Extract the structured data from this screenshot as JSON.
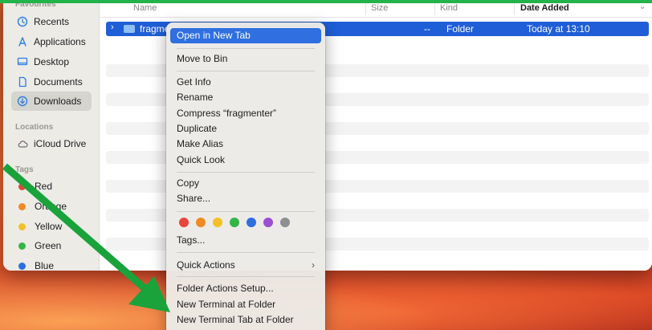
{
  "sidebar": {
    "favourites_heading": "Favourites",
    "items": [
      {
        "label": "Recents",
        "icon": "clock-icon"
      },
      {
        "label": "Applications",
        "icon": "applications-icon"
      },
      {
        "label": "Desktop",
        "icon": "desktop-icon"
      },
      {
        "label": "Documents",
        "icon": "document-icon"
      },
      {
        "label": "Downloads",
        "icon": "download-icon",
        "selected": true
      }
    ],
    "locations_heading": "Locations",
    "locations": [
      {
        "label": "iCloud Drive",
        "icon": "cloud-icon"
      }
    ],
    "tags_heading": "Tags",
    "tags": [
      {
        "label": "Red",
        "color": "#e8453c"
      },
      {
        "label": "Orange",
        "color": "#f08a24"
      },
      {
        "label": "Yellow",
        "color": "#f3c125"
      },
      {
        "label": "Green",
        "color": "#34b546"
      },
      {
        "label": "Blue",
        "color": "#2d6fe0"
      }
    ]
  },
  "columns": {
    "name": "Name",
    "size": "Size",
    "kind": "Kind",
    "date_added": "Date Added"
  },
  "selected_row": {
    "name": "fragmenter",
    "size": "--",
    "kind": "Folder",
    "date_added": "Today at 13:10"
  },
  "context_menu": {
    "open_new_tab": "Open in New Tab",
    "move_to_bin": "Move to Bin",
    "get_info": "Get Info",
    "rename": "Rename",
    "compress": "Compress “fragmenter”",
    "duplicate": "Duplicate",
    "make_alias": "Make Alias",
    "quick_look": "Quick Look",
    "copy": "Copy",
    "share": "Share...",
    "tag_colors": [
      "#e8453c",
      "#f08a24",
      "#f3c125",
      "#34b546",
      "#2d6fe0",
      "#9b4fd1",
      "#8e8e93"
    ],
    "tags": "Tags...",
    "quick_actions": "Quick Actions",
    "folder_actions_setup": "Folder Actions Setup...",
    "new_terminal": "New Terminal at Folder",
    "new_terminal_tab": "New Terminal Tab at Folder"
  },
  "colors": {
    "selection_blue": "#1f5ed6",
    "annotation_arrow": "#19a33a"
  }
}
